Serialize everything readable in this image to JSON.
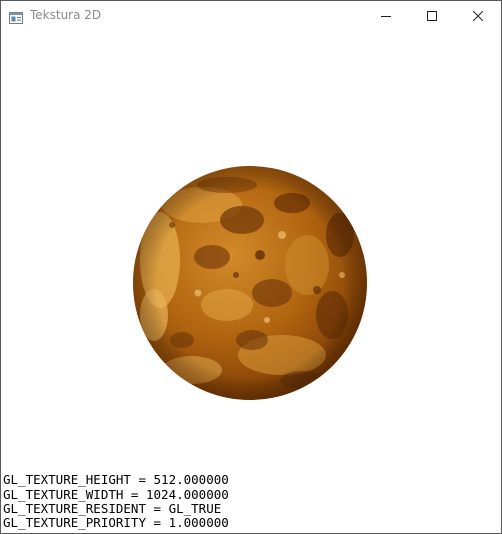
{
  "window": {
    "title": "Tekstura 2D",
    "app_icon": "opengl-window-icon",
    "controls": {
      "minimize_icon": "minimize-icon",
      "maximize_icon": "maximize-icon",
      "close_icon": "close-icon"
    }
  },
  "scene": {
    "object": "textured-sphere-venus",
    "colors": {
      "background": "#ffffff",
      "planet_light": "#e0a13c",
      "planet_mid": "#b26a14",
      "planet_dark": "#5a2a05"
    }
  },
  "gl_info": [
    "GL_TEXTURE_HEIGHT = 512.000000",
    "GL_TEXTURE_WIDTH = 1024.000000",
    "GL_TEXTURE_RESIDENT = GL_TRUE",
    "GL_TEXTURE_PRIORITY = 1.000000"
  ]
}
